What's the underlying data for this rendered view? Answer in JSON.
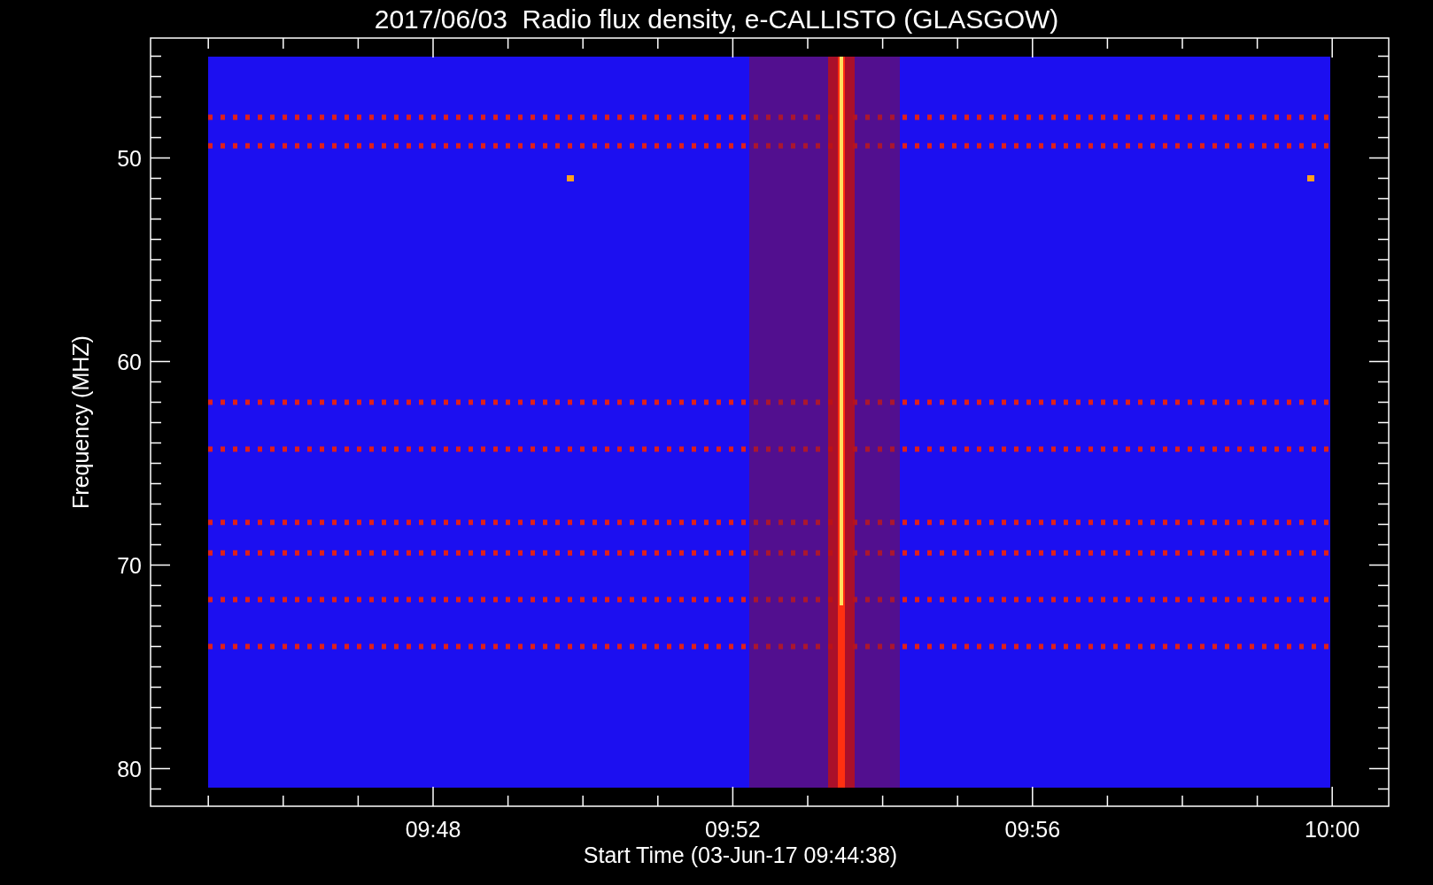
{
  "title": "2017/06/03  Radio flux density, e-CALLISTO (GLASGOW)",
  "y_axis": {
    "label": "Frequency (MHZ)",
    "ticks": [
      "50",
      "60",
      "70",
      "80"
    ]
  },
  "x_axis": {
    "label": "Start Time (03-Jun-17 09:44:38)",
    "ticks": [
      "09:48",
      "09:52",
      "09:56",
      "10:00"
    ]
  }
}
